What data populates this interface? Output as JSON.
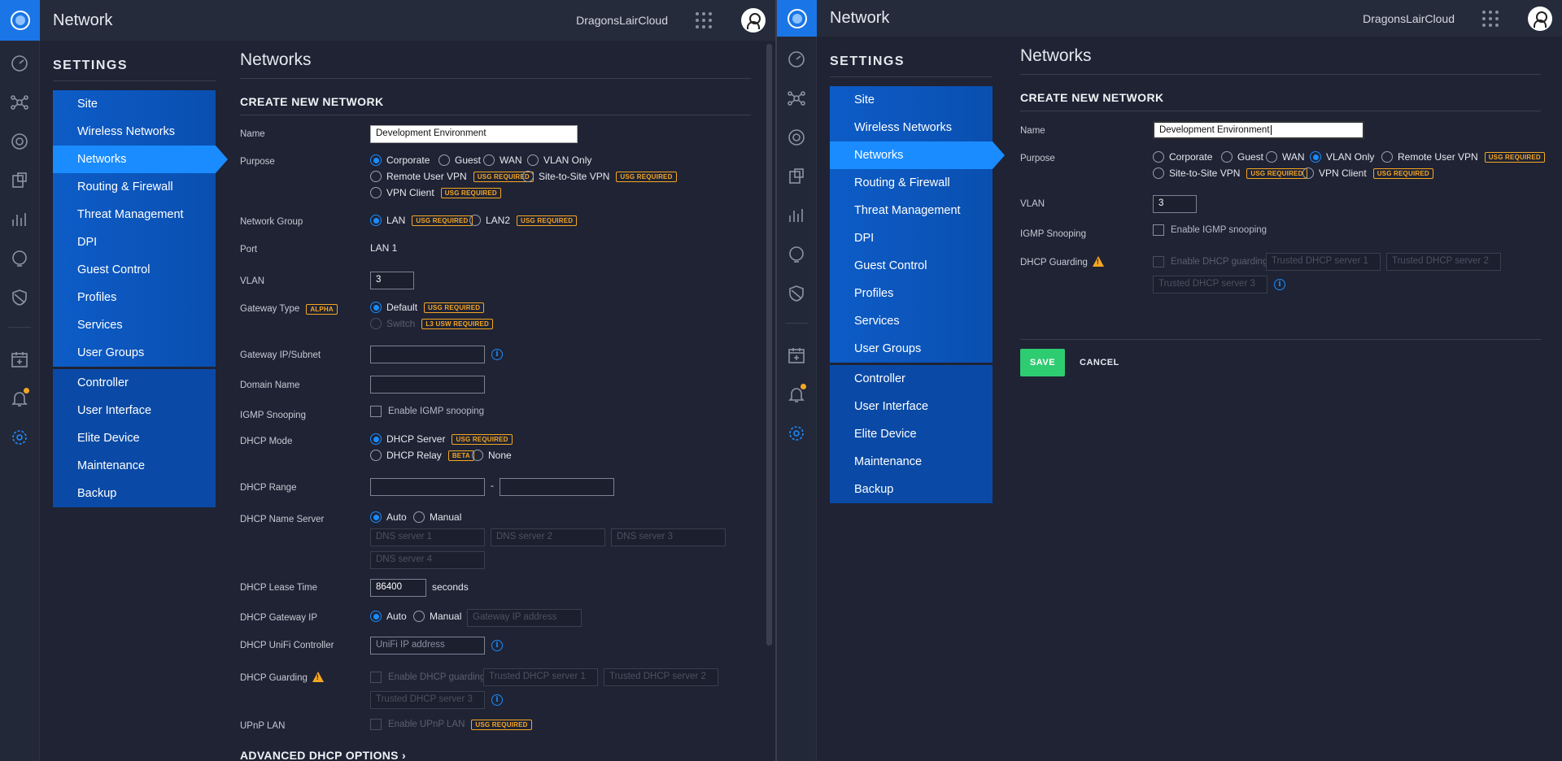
{
  "app_title": "Network",
  "site_name": "DragonsLairCloud",
  "settings_heading": "SETTINGS",
  "menu": {
    "items": [
      "Site",
      "Wireless Networks",
      "Networks",
      "Routing & Firewall",
      "Threat Management",
      "DPI",
      "Guest Control",
      "Profiles",
      "Services",
      "User Groups"
    ],
    "group2": [
      "Controller",
      "User Interface",
      "Elite Device",
      "Maintenance",
      "Backup"
    ]
  },
  "page_title": "Networks",
  "section_title": "CREATE NEW NETWORK",
  "tags": {
    "usg": "USG REQUIRED",
    "alpha": "ALPHA",
    "l3": "L3 USW REQUIRED",
    "beta": "BETA"
  },
  "left_form": {
    "name_label": "Name",
    "name_value": "Development Environment",
    "purpose_label": "Purpose",
    "purpose_options": [
      "Corporate",
      "Guest",
      "WAN",
      "VLAN Only",
      "Remote User VPN",
      "Site-to-Site VPN",
      "VPN Client"
    ],
    "network_group_label": "Network Group",
    "network_group_options": [
      "LAN",
      "LAN2"
    ],
    "port_label": "Port",
    "port_value": "LAN 1",
    "vlan_label": "VLAN",
    "vlan_value": "3",
    "gateway_type_label": "Gateway Type",
    "gateway_type_options": [
      "Default",
      "Switch"
    ],
    "gateway_ip_label": "Gateway IP/Subnet",
    "domain_label": "Domain Name",
    "igmp_label": "IGMP Snooping",
    "igmp_option": "Enable IGMP snooping",
    "dhcp_mode_label": "DHCP Mode",
    "dhcp_mode_options": [
      "DHCP Server",
      "DHCP Relay",
      "None"
    ],
    "dhcp_range_label": "DHCP Range",
    "dhcp_range_sep": "-",
    "dhcp_ns_label": "DHCP Name Server",
    "auto": "Auto",
    "manual": "Manual",
    "dns_placeholders": [
      "DNS server 1",
      "DNS server 2",
      "DNS server 3",
      "DNS server 4"
    ],
    "lease_label": "DHCP Lease Time",
    "lease_value": "86400",
    "lease_unit": "seconds",
    "gw_ip_label": "DHCP Gateway IP",
    "gw_ip_placeholder": "Gateway IP address",
    "unifi_label": "DHCP UniFi Controller",
    "unifi_placeholder": "UniFi IP address",
    "guard_label": "DHCP Guarding",
    "guard_option": "Enable DHCP guarding",
    "trusted_placeholders": [
      "Trusted DHCP server 1",
      "Trusted DHCP server 2",
      "Trusted DHCP server 3"
    ],
    "upnp_label": "UPnP LAN",
    "upnp_option": "Enable UPnP LAN",
    "advanced": "ADVANCED DHCP OPTIONS"
  },
  "right_form": {
    "name_label": "Name",
    "name_value": "Development Environment",
    "purpose_label": "Purpose",
    "purpose_options": [
      "Corporate",
      "Guest",
      "WAN",
      "VLAN Only",
      "Remote User VPN",
      "Site-to-Site VPN",
      "VPN Client"
    ],
    "vlan_label": "VLAN",
    "vlan_value": "3",
    "igmp_label": "IGMP Snooping",
    "igmp_option": "Enable IGMP snooping",
    "guard_label": "DHCP Guarding",
    "guard_option": "Enable DHCP guarding",
    "trusted_placeholders": [
      "Trusted DHCP server 1",
      "Trusted DHCP server 2",
      "Trusted DHCP server 3"
    ],
    "save": "SAVE",
    "cancel": "CANCEL"
  },
  "colors": {
    "accent": "#1a8cff",
    "menu_blue": "#0d5cc7",
    "save_green": "#2ecc71",
    "tag_orange": "#f5a623"
  }
}
